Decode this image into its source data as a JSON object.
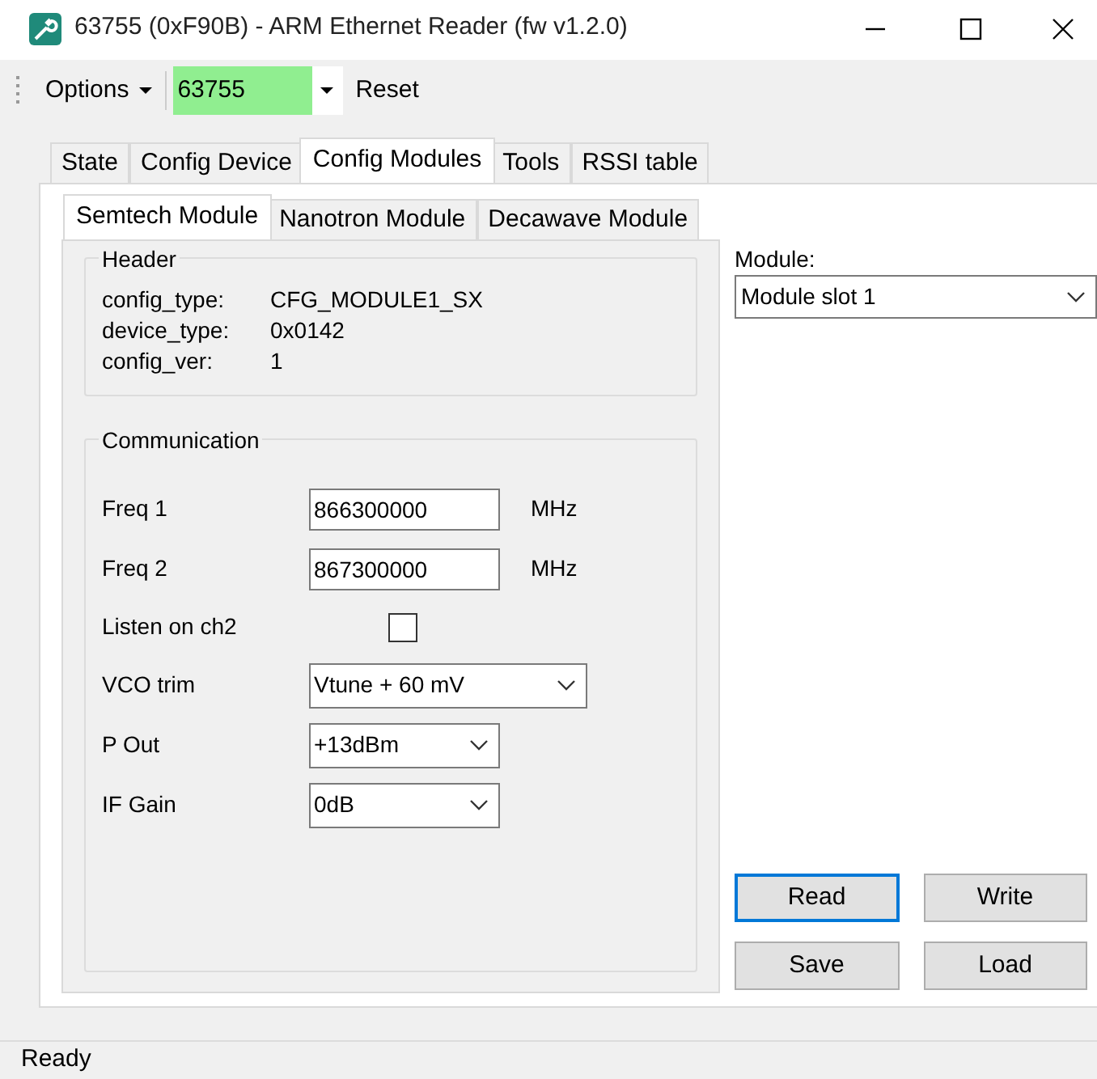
{
  "window": {
    "title": "63755 (0xF90B) - ARM Ethernet Reader (fw v1.2.0)"
  },
  "toolbar": {
    "options_menu": "Options",
    "device_combo": {
      "value": "63755"
    },
    "reset": "Reset"
  },
  "tabs": [
    {
      "label": "State",
      "selected": false
    },
    {
      "label": "Config Device",
      "selected": false
    },
    {
      "label": "Config Modules",
      "selected": true
    },
    {
      "label": "Tools",
      "selected": false
    },
    {
      "label": "RSSI table",
      "selected": false
    }
  ],
  "module_tabs": [
    {
      "label": "Semtech Module",
      "selected": true
    },
    {
      "label": "Nanotron Module",
      "selected": false
    },
    {
      "label": "Decawave Module",
      "selected": false
    }
  ],
  "header": {
    "title": "Header",
    "fields": [
      {
        "label": "config_type:",
        "value": "CFG_MODULE1_SX"
      },
      {
        "label": "device_type:",
        "value": "0x0142"
      },
      {
        "label": "config_ver:",
        "value": "1"
      }
    ]
  },
  "communication": {
    "title": "Communication",
    "rows": [
      {
        "kind": "text",
        "label": "Freq 1",
        "value": "866300000",
        "unit": "MHz"
      },
      {
        "kind": "text",
        "label": "Freq 2",
        "value": "867300000",
        "unit": "MHz"
      },
      {
        "kind": "checkbox",
        "label": "Listen on ch2",
        "checked": false
      },
      {
        "kind": "dropdown",
        "label": "VCO trim",
        "value": "Vtune + 60 mV",
        "wide": true
      },
      {
        "kind": "dropdown",
        "label": "P Out",
        "value": "+13dBm",
        "wide": false
      },
      {
        "kind": "dropdown",
        "label": "IF Gain",
        "value": "0dB",
        "wide": false
      }
    ]
  },
  "module": {
    "label": "Module:",
    "value": "Module slot 1"
  },
  "buttons": [
    {
      "label": "Read",
      "focused": true
    },
    {
      "label": "Write",
      "focused": false
    },
    {
      "label": "Save",
      "focused": false
    },
    {
      "label": "Load",
      "focused": false
    }
  ],
  "status_bar": "Ready"
}
